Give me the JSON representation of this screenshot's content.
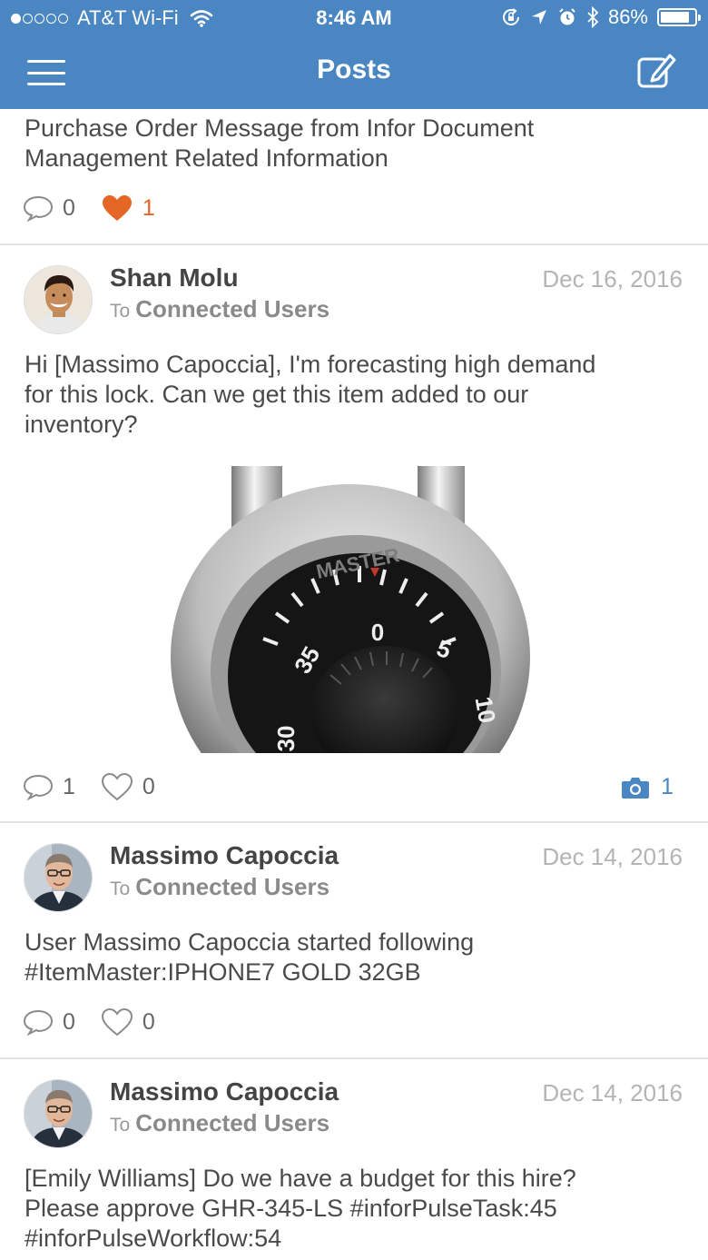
{
  "status": {
    "carrier": "AT&T Wi-Fi",
    "time": "8:46 AM",
    "battery": "86%",
    "battery_level": 0.86
  },
  "nav": {
    "title": "Posts"
  },
  "posts": [
    {
      "text_lines": [
        "Purchase Order Message from Infor Document",
        "Management Related Information"
      ],
      "comments": "0",
      "likes": "1",
      "liked": true
    },
    {
      "author": "Shan Molu",
      "to_prefix": "To",
      "to_group": "Connected Users",
      "date": "Dec 16, 2016",
      "text_lines": [
        "Hi [Massimo Capoccia], I'm forecasting high demand",
        "for this lock. Can we get this item added to our",
        "inventory?"
      ],
      "comments": "1",
      "likes": "0",
      "attachments": "1"
    },
    {
      "author": "Massimo Capoccia",
      "to_prefix": "To",
      "to_group": "Connected Users",
      "date": "Dec 14, 2016",
      "text_lines": [
        "User Massimo Capoccia started following",
        "#ItemMaster:IPHONE7 GOLD 32GB"
      ],
      "comments": "0",
      "likes": "0"
    },
    {
      "author": "Massimo Capoccia",
      "to_prefix": "To",
      "to_group": "Connected Users",
      "date": "Dec 14, 2016",
      "text_lines": [
        "[Emily Williams] Do we have a budget for this hire?",
        "Please approve GHR-345-LS #inforPulseTask:45",
        "#inforPulseWorkflow:54"
      ]
    }
  ],
  "colors": {
    "header": "#4a87c2",
    "like_active": "#e46625"
  },
  "lock": {
    "brand": "MASTER",
    "dial_numbers": [
      "0",
      "5",
      "35",
      "30",
      "10"
    ]
  }
}
